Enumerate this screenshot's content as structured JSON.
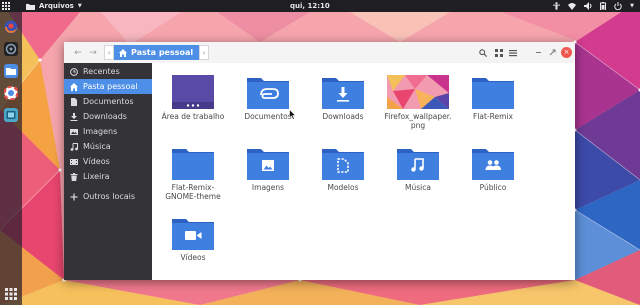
{
  "colors": {
    "accent": "#4d8ee6",
    "folder": "#3f7fe0",
    "folder_dark": "#2d62c4",
    "sidebar_bg": "#333338",
    "close": "#f0584f"
  },
  "top_panel": {
    "activities_icon": "grid-icon",
    "app_name": "Arquivos",
    "clock": "qui, 12:10",
    "tray_icons": [
      "accessibility-icon",
      "network-icon",
      "volume-icon",
      "battery-icon",
      "power-icon"
    ]
  },
  "dock": {
    "items": [
      "firefox-icon",
      "terminal-icon",
      "files-icon",
      "help-icon",
      "screenshot-icon"
    ],
    "apps_icon": "show-apps-icon"
  },
  "window": {
    "path": {
      "current": "Pasta pessoal"
    },
    "sidebar": [
      {
        "label": "Recentes",
        "icon": "clock-icon",
        "active": false
      },
      {
        "label": "Pasta pessoal",
        "icon": "home-icon",
        "active": true
      },
      {
        "label": "Documentos",
        "icon": "document-icon",
        "active": false
      },
      {
        "label": "Downloads",
        "icon": "download-icon",
        "active": false
      },
      {
        "label": "Imagens",
        "icon": "image-icon",
        "active": false
      },
      {
        "label": "Música",
        "icon": "music-icon",
        "active": false
      },
      {
        "label": "Vídeos",
        "icon": "video-icon",
        "active": false
      },
      {
        "label": "Lixeira",
        "icon": "trash-icon",
        "active": false
      },
      {
        "label": "Outros locais",
        "icon": "plus-icon",
        "active": false
      }
    ],
    "files": [
      {
        "name": "Área de trabalho",
        "icon": "desktop-folder-icon"
      },
      {
        "name": "Documentos",
        "icon": "documents-folder-icon"
      },
      {
        "name": "Downloads",
        "icon": "downloads-folder-icon"
      },
      {
        "name": "Firefox_wallpaper.png",
        "icon": "image-thumbnail-icon"
      },
      {
        "name": "Flat-Remix",
        "icon": "folder-icon"
      },
      {
        "name": "Flat-Remix-GNOME-theme",
        "icon": "folder-icon"
      },
      {
        "name": "Imagens",
        "icon": "pictures-folder-icon"
      },
      {
        "name": "Modelos",
        "icon": "templates-folder-icon"
      },
      {
        "name": "Música",
        "icon": "music-folder-icon"
      },
      {
        "name": "Público",
        "icon": "public-folder-icon"
      },
      {
        "name": "Vídeos",
        "icon": "videos-folder-icon"
      }
    ]
  }
}
